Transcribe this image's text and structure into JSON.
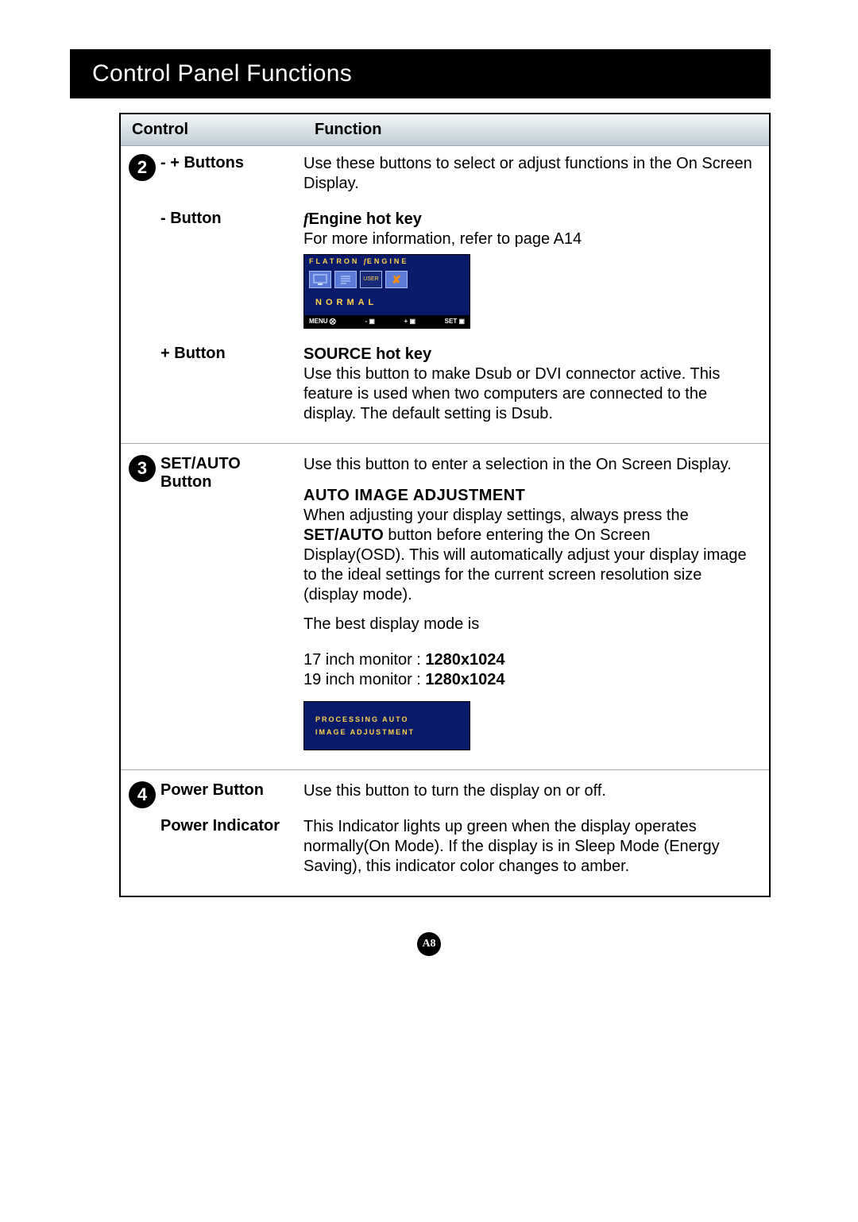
{
  "title": "Control Panel Functions",
  "headers": {
    "control": "Control",
    "function": "Function"
  },
  "rows": {
    "r2a": {
      "num": "2",
      "control_prefix": "-   + ",
      "control": "Buttons",
      "func": "Use these buttons to select or adjust functions in the On Screen Display."
    },
    "r2b": {
      "control_prefix": "- ",
      "control": "Button",
      "title_prefix": "f",
      "title_engine": "Engine",
      "title_suffix": "  hot key",
      "func": "For more information, refer to page A14",
      "osd": {
        "hdr_flatron": "FLATRON",
        "hdr_f": "f",
        "hdr_engine": "ENGINE",
        "normal": "NORMAL",
        "user_label": "USER",
        "bottom_menu": "MENU ⨂",
        "bottom_minus": "- ▣",
        "bottom_plus": "+ ▣",
        "bottom_set": "SET ▣"
      }
    },
    "r2c": {
      "control_prefix": "+ ",
      "control": "Button",
      "title": "SOURCE hot key",
      "func": "Use this button to make Dsub or DVI connector active. This feature is used when two computers are connected to the display. The default setting is Dsub."
    },
    "r3": {
      "num": "3",
      "control_l1": "SET/AUTO",
      "control_l2": "Button",
      "func_intro": "Use this button to enter a selection in the On Screen Display.",
      "auto_hdr": "AUTO IMAGE ADJUSTMENT",
      "auto_p1a": "When adjusting your display settings, always press the ",
      "auto_bold": "SET/AUTO",
      "auto_p1b": " button before entering the On Screen Display(OSD). This will automatically adjust your display image to the ideal settings for the current screen resolution size (display mode).",
      "best_mode": "The best display mode is",
      "res17a": "17 inch monitor : ",
      "res17b": "1280x1024",
      "res19a": "19 inch monitor : ",
      "res19b": "1280x1024",
      "proc_l1": "PROCESSING AUTO",
      "proc_l2": "IMAGE ADJUSTMENT"
    },
    "r4a": {
      "num": "4",
      "control": "Power Button",
      "func": "Use this button to turn the display on or off."
    },
    "r4b": {
      "control": "Power Indicator",
      "func": "This Indicator lights up green when the display operates normally(On Mode). If the display is in Sleep Mode (Energy Saving), this indicator color changes to amber."
    }
  },
  "page_number": "A8"
}
